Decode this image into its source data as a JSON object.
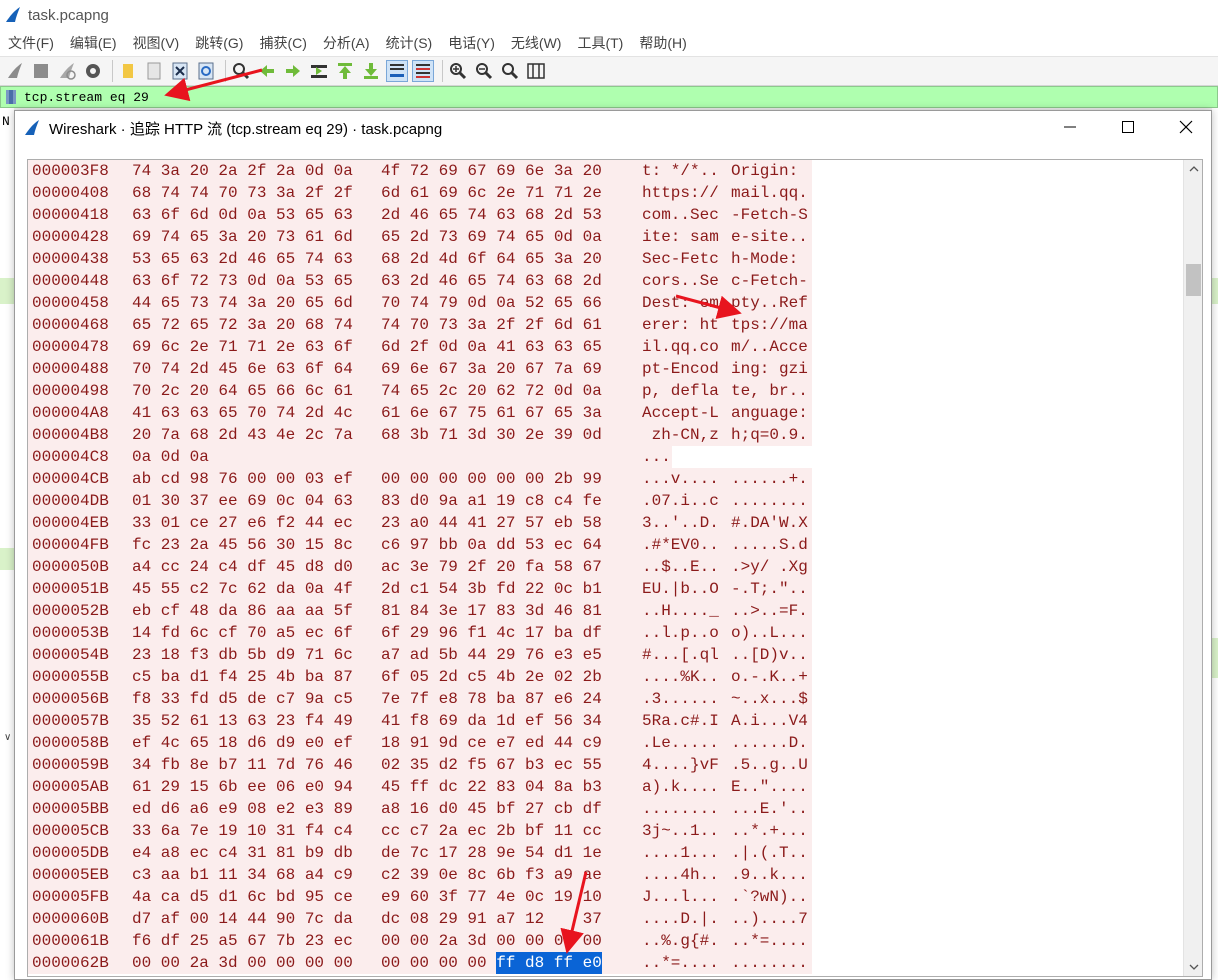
{
  "window": {
    "title": "task.pcapng"
  },
  "menu": [
    "文件(F)",
    "编辑(E)",
    "视图(V)",
    "跳转(G)",
    "捕获(C)",
    "分析(A)",
    "统计(S)",
    "电话(Y)",
    "无线(W)",
    "工具(T)",
    "帮助(H)"
  ],
  "toolbar_icons": [
    "shark-start-icon",
    "stop-icon",
    "restart-icon",
    "options-gear-icon",
    "open-folder-icon",
    "file-icon",
    "close-file-icon",
    "reload-icon",
    "find-icon",
    "go-back-icon",
    "go-forward-icon",
    "go-to-packet-icon",
    "first-packet-icon",
    "last-packet-icon",
    "autoscroll-icon",
    "colorize-icon",
    "zoom-in-icon",
    "zoom-out-icon",
    "zoom-normal-icon",
    "resize-columns-icon"
  ],
  "filter": {
    "text": "tcp.stream eq 29"
  },
  "background": {
    "left_char": "N"
  },
  "dialog": {
    "title": "Wireshark · 追踪 HTTP 流 (tcp.stream eq 29) · task.pcapng"
  },
  "colors": {
    "client_text": "#8b1a1a",
    "client_bg": "#fbeded",
    "selection": "#0a64d6",
    "filter_ok": "#afffaf",
    "arrow": "#e8141e"
  },
  "stream": {
    "rows": [
      {
        "off": "000003F8",
        "h1": "74 3a 20 2a 2f 2a 0d 0a",
        "h2": "4f 72 69 67 69 6e 3a 20",
        "a1": "t: */*..",
        "a2": "Origin: "
      },
      {
        "off": "00000408",
        "h1": "68 74 74 70 73 3a 2f 2f",
        "h2": "6d 61 69 6c 2e 71 71 2e",
        "a1": "https://",
        "a2": "mail.qq."
      },
      {
        "off": "00000418",
        "h1": "63 6f 6d 0d 0a 53 65 63",
        "h2": "2d 46 65 74 63 68 2d 53",
        "a1": "com..Sec",
        "a2": "-Fetch-S"
      },
      {
        "off": "00000428",
        "h1": "69 74 65 3a 20 73 61 6d",
        "h2": "65 2d 73 69 74 65 0d 0a",
        "a1": "ite: sam",
        "a2": "e-site.."
      },
      {
        "off": "00000438",
        "h1": "53 65 63 2d 46 65 74 63",
        "h2": "68 2d 4d 6f 64 65 3a 20",
        "a1": "Sec-Fetc",
        "a2": "h-Mode: "
      },
      {
        "off": "00000448",
        "h1": "63 6f 72 73 0d 0a 53 65",
        "h2": "63 2d 46 65 74 63 68 2d",
        "a1": "cors..Se",
        "a2": "c-Fetch-"
      },
      {
        "off": "00000458",
        "h1": "44 65 73 74 3a 20 65 6d",
        "h2": "70 74 79 0d 0a 52 65 66",
        "a1": "Dest: em",
        "a2": "pty..Ref"
      },
      {
        "off": "00000468",
        "h1": "65 72 65 72 3a 20 68 74",
        "h2": "74 70 73 3a 2f 2f 6d 61",
        "a1": "erer: ht",
        "a2": "tps://ma"
      },
      {
        "off": "00000478",
        "h1": "69 6c 2e 71 71 2e 63 6f",
        "h2": "6d 2f 0d 0a 41 63 63 65",
        "a1": "il.qq.co",
        "a2": "m/..Acce"
      },
      {
        "off": "00000488",
        "h1": "70 74 2d 45 6e 63 6f 64",
        "h2": "69 6e 67 3a 20 67 7a 69",
        "a1": "pt-Encod",
        "a2": "ing: gzi"
      },
      {
        "off": "00000498",
        "h1": "70 2c 20 64 65 66 6c 61",
        "h2": "74 65 2c 20 62 72 0d 0a",
        "a1": "p, defla",
        "a2": "te, br.."
      },
      {
        "off": "000004A8",
        "h1": "41 63 63 65 70 74 2d 4c",
        "h2": "61 6e 67 75 61 67 65 3a",
        "a1": "Accept-L",
        "a2": "anguage:"
      },
      {
        "off": "000004B8",
        "h1": "20 7a 68 2d 43 4e 2c 7a",
        "h2": "68 3b 71 3d 30 2e 39 0d",
        "a1": " zh-CN,z",
        "a2": "h;q=0.9."
      },
      {
        "off": "000004C8",
        "h1": "0a 0d 0a",
        "h2": "",
        "a1": "...",
        "a2": ""
      },
      {
        "off": "000004CB",
        "h1": "ab cd 98 76 00 00 03 ef",
        "h2": "00 00 00 00 00 00 2b 99",
        "a1": "...v....",
        "a2": "......+."
      },
      {
        "off": "000004DB",
        "h1": "01 30 37 ee 69 0c 04 63",
        "h2": "83 d0 9a a1 19 c8 c4 fe",
        "a1": ".07.i..c",
        "a2": "........"
      },
      {
        "off": "000004EB",
        "h1": "33 01 ce 27 e6 f2 44 ec",
        "h2": "23 a0 44 41 27 57 eb 58",
        "a1": "3..'..D.",
        "a2": "#.DA'W.X"
      },
      {
        "off": "000004FB",
        "h1": "fc 23 2a 45 56 30 15 8c",
        "h2": "c6 97 bb 0a dd 53 ec 64",
        "a1": ".#*EV0..",
        "a2": ".....S.d"
      },
      {
        "off": "0000050B",
        "h1": "a4 cc 24 c4 df 45 d8 d0",
        "h2": "ac 3e 79 2f 20 fa 58 67",
        "a1": "..$..E..",
        "a2": ".>y/ .Xg"
      },
      {
        "off": "0000051B",
        "h1": "45 55 c2 7c 62 da 0a 4f",
        "h2": "2d c1 54 3b fd 22 0c b1",
        "a1": "EU.|b..O",
        "a2": "-.T;.\".."
      },
      {
        "off": "0000052B",
        "h1": "eb cf 48 da 86 aa aa 5f",
        "h2": "81 84 3e 17 83 3d 46 81",
        "a1": "..H...._",
        "a2": "..>..=F."
      },
      {
        "off": "0000053B",
        "h1": "14 fd 6c cf 70 a5 ec 6f",
        "h2": "6f 29 96 f1 4c 17 ba df",
        "a1": "..l.p..o",
        "a2": "o)..L..."
      },
      {
        "off": "0000054B",
        "h1": "23 18 f3 db 5b d9 71 6c",
        "h2": "a7 ad 5b 44 29 76 e3 e5",
        "a1": "#...[.ql",
        "a2": "..[D)v.."
      },
      {
        "off": "0000055B",
        "h1": "c5 ba d1 f4 25 4b ba 87",
        "h2": "6f 05 2d c5 4b 2e 02 2b",
        "a1": "....%K..",
        "a2": "o.-.K..+"
      },
      {
        "off": "0000056B",
        "h1": "f8 33 fd d5 de c7 9a c5",
        "h2": "7e 7f e8 78 ba 87 e6 24",
        "a1": ".3......",
        "a2": "~..x...$"
      },
      {
        "off": "0000057B",
        "h1": "35 52 61 13 63 23 f4 49",
        "h2": "41 f8 69 da 1d ef 56 34",
        "a1": "5Ra.c#.I",
        "a2": "A.i...V4"
      },
      {
        "off": "0000058B",
        "h1": "ef 4c 65 18 d6 d9 e0 ef",
        "h2": "18 91 9d ce e7 ed 44 c9",
        "a1": ".Le.....",
        "a2": "......D."
      },
      {
        "off": "0000059B",
        "h1": "34 fb 8e b7 11 7d 76 46",
        "h2": "02 35 d2 f5 67 b3 ec 55",
        "a1": "4....}vF",
        "a2": ".5..g..U"
      },
      {
        "off": "000005AB",
        "h1": "61 29 15 6b ee 06 e0 94",
        "h2": "45 ff dc 22 83 04 8a b3",
        "a1": "a).k....",
        "a2": "E..\"...."
      },
      {
        "off": "000005BB",
        "h1": "ed d6 a6 e9 08 e2 e3 89",
        "h2": "a8 16 d0 45 bf 27 cb df",
        "a1": "........",
        "a2": "...E.'.."
      },
      {
        "off": "000005CB",
        "h1": "33 6a 7e 19 10 31 f4 c4",
        "h2": "cc c7 2a ec 2b bf 11 cc",
        "a1": "3j~..1..",
        "a2": "..*.+..."
      },
      {
        "off": "000005DB",
        "h1": "e4 a8 ec c4 31 81 b9 db",
        "h2": "de 7c 17 28 9e 54 d1 1e",
        "a1": "....1...",
        "a2": ".|.(.T.."
      },
      {
        "off": "000005EB",
        "h1": "c3 aa b1 11 34 68 a4 c9",
        "h2": "c2 39 0e 8c 6b f3 a9 ae",
        "a1": "....4h..",
        "a2": ".9..k..."
      },
      {
        "off": "000005FB",
        "h1": "4a ca d5 d1 6c bd 95 ce",
        "h2": "e9 60 3f 77 4e 0c 19 10",
        "a1": "J...l...",
        "a2": ".`?wN).."
      },
      {
        "off": "0000060B",
        "h1": "d7 af 00 14 44 90 7c da",
        "h2": "dc 08 29 91 a7 12 ",
        "a1": "....D.|.",
        "a2": "..)....7"
      },
      {
        "off": "0000061B",
        "h1": "f6 df 25 a5 67 7b 23 ec",
        "h2": "00 00 2a 3d 00 00 00 00",
        "a1": "..%.g{#.",
        "a2": "..*=...."
      },
      {
        "off": "0000062B",
        "h1": "00 00 2a 3d 00 00 00 00",
        "h2": "00 00 00 00 ",
        "sel": "ff d8 ff e0",
        "a1": "..*=....",
        "a2": "........"
      }
    ],
    "row_60B_tail": "37"
  }
}
